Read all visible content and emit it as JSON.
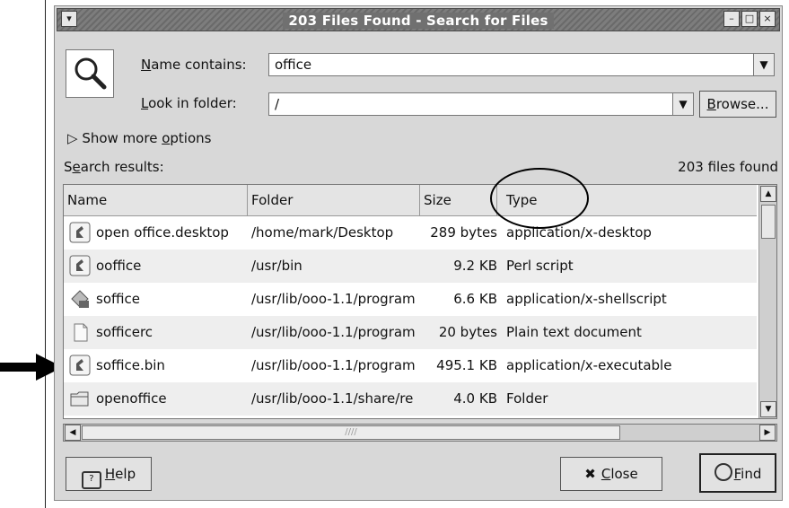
{
  "window": {
    "title": "203 Files Found - Search for Files",
    "wm_buttons": [
      "▾",
      "–",
      "□",
      "×"
    ]
  },
  "form": {
    "name_label_prefix": "",
    "name_label_mnemonic": "N",
    "name_label_rest": "ame contains:",
    "name_value": "office",
    "folder_label_mnemonic": "L",
    "folder_label_rest": "ook in folder:",
    "folder_value": "/",
    "browse_mnemonic": "B",
    "browse_rest": "rowse...",
    "more_options_prefix": "Show more ",
    "more_options_mnemonic": "o",
    "more_options_rest": "ptions",
    "disclosure": "▷"
  },
  "results": {
    "label_s": "S",
    "label_e": "e",
    "label_rest": "arch results:",
    "count": "203 files found",
    "columns": [
      "Name",
      "Folder",
      "Size",
      "Type"
    ],
    "rows": [
      {
        "icon": "desktop-file-icon",
        "name": "open office.desktop",
        "folder": "/home/mark/Desktop",
        "size": "289 bytes",
        "type": "application/x-desktop"
      },
      {
        "icon": "executable-icon",
        "name": "ooffice",
        "folder": "/usr/bin",
        "size": "9.2 KB",
        "type": "Perl script"
      },
      {
        "icon": "shellscript-icon",
        "name": "soffice",
        "folder": "/usr/lib/ooo-1.1/program",
        "size": "6.6 KB",
        "type": "application/x-shellscript"
      },
      {
        "icon": "text-document-icon",
        "name": "sofficerc",
        "folder": "/usr/lib/ooo-1.1/program",
        "size": "20 bytes",
        "type": "Plain text document"
      },
      {
        "icon": "executable-icon",
        "name": "soffice.bin",
        "folder": "/usr/lib/ooo-1.1/program",
        "size": "495.1 KB",
        "type": "application/x-executable"
      },
      {
        "icon": "folder-icon",
        "name": "openoffice",
        "folder": "/usr/lib/ooo-1.1/share/re",
        "size": "4.0 KB",
        "type": "Folder"
      }
    ]
  },
  "buttons": {
    "help_mnemonic": "H",
    "help_rest": "elp",
    "close_mnemonic": "C",
    "close_rest": "lose",
    "find_mnemonic": "F",
    "find_rest": "ind"
  }
}
